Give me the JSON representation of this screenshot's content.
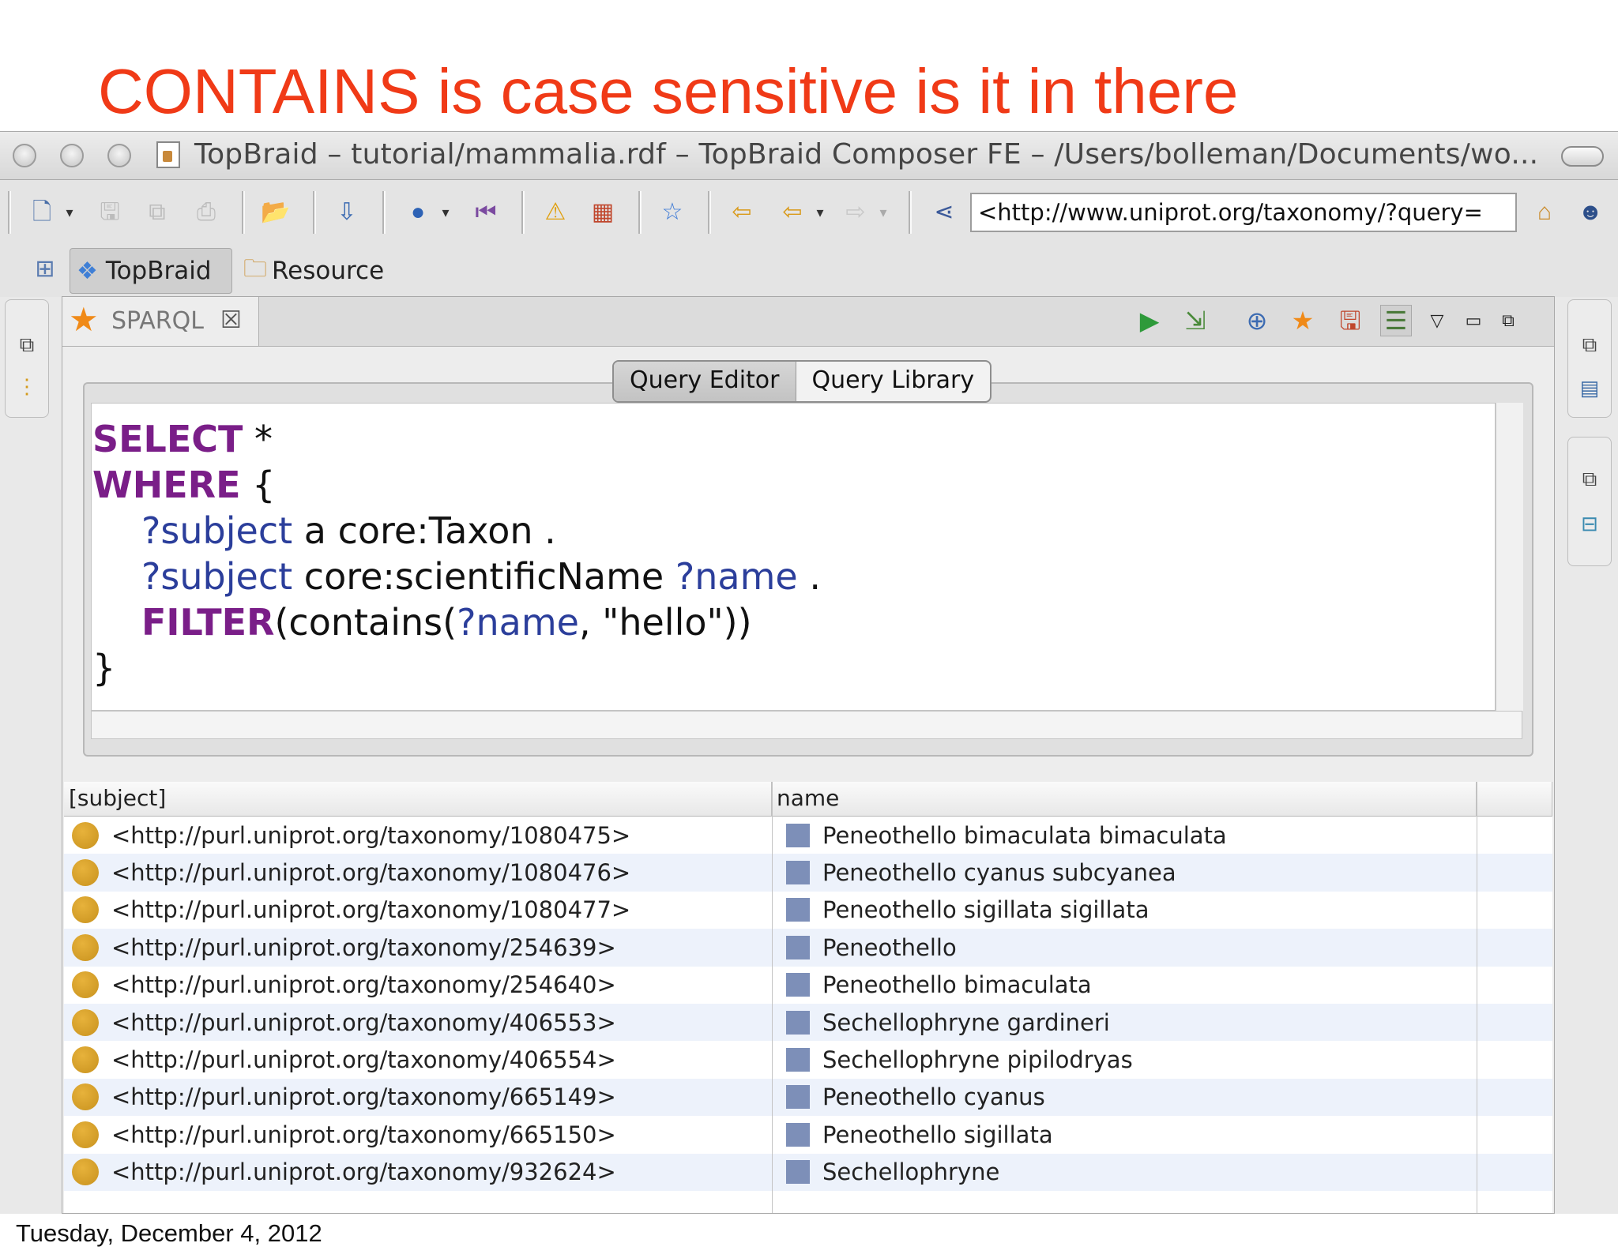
{
  "slide": {
    "title": "CONTAINS is case sensitive is it in there",
    "footer_date": "Tuesday, December 4, 2012"
  },
  "window": {
    "title": "TopBraid – tutorial/mammalia.rdf – TopBraid Composer FE – /Users/bolleman/Documents/wo..."
  },
  "toolbar": {
    "address": "<http://www.uniprot.org/taxonomy/?query="
  },
  "perspectives": {
    "topbraid_label": "TopBraid",
    "resource_label": "Resource"
  },
  "editor": {
    "tab_label": "SPARQL",
    "subtabs": [
      "Query Editor",
      "Query Library"
    ],
    "query_lines": [
      {
        "kw": "SELECT",
        "rest": " *"
      },
      {
        "kw": "WHERE",
        "rest": " {"
      },
      {
        "v1": "?subject",
        "rest": " a core:Taxon ."
      },
      {
        "v1": "?subject",
        "mid": " core:scientificName ",
        "v2": "?name",
        "rest": " ."
      },
      {
        "kw": "FILTER",
        "mid": "(contains(",
        "v2": "?name",
        "rest": ", \"hello\"))"
      },
      {
        "rest": "}"
      }
    ]
  },
  "results": {
    "columns": [
      "[subject]",
      "name"
    ],
    "rows": [
      {
        "subject": "<http://purl.uniprot.org/taxonomy/1080475>",
        "name": "Peneothello bimaculata bimaculata"
      },
      {
        "subject": "<http://purl.uniprot.org/taxonomy/1080476>",
        "name": "Peneothello cyanus subcyanea"
      },
      {
        "subject": "<http://purl.uniprot.org/taxonomy/1080477>",
        "name": "Peneothello sigillata sigillata"
      },
      {
        "subject": "<http://purl.uniprot.org/taxonomy/254639>",
        "name": "Peneothello"
      },
      {
        "subject": "<http://purl.uniprot.org/taxonomy/254640>",
        "name": "Peneothello bimaculata"
      },
      {
        "subject": "<http://purl.uniprot.org/taxonomy/406553>",
        "name": "Sechellophryne gardineri"
      },
      {
        "subject": "<http://purl.uniprot.org/taxonomy/406554>",
        "name": "Sechellophryne pipilodryas"
      },
      {
        "subject": "<http://purl.uniprot.org/taxonomy/665149>",
        "name": "Peneothello cyanus"
      },
      {
        "subject": "<http://purl.uniprot.org/taxonomy/665150>",
        "name": "Peneothello sigillata"
      },
      {
        "subject": "<http://purl.uniprot.org/taxonomy/932624>",
        "name": "Sechellophryne"
      }
    ]
  },
  "colors": {
    "title_red": "#f03a17",
    "keyword_purple": "#7a1e88",
    "variable_blue": "#2b3e9b",
    "subject_dot": "#d9a12c",
    "name_square": "#7d8fb8"
  }
}
